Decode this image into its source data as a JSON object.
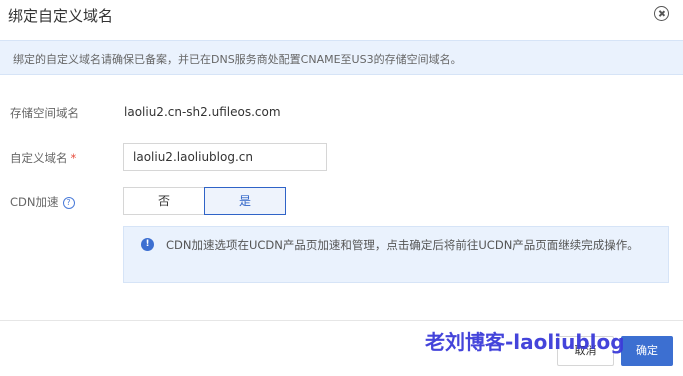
{
  "dialog": {
    "title": "绑定自定义域名"
  },
  "notice": {
    "text": "绑定的自定义域名请确保已备案，并已在DNS服务商处配置CNAME至US3的存储空间域名。"
  },
  "form": {
    "bucket_domain_label": "存储空间域名",
    "bucket_domain_value": "laoliu2.cn-sh2.ufileos.com",
    "custom_domain_label": "自定义域名",
    "required_mark": "*",
    "custom_domain_value": "laoliu2.laoliublog.cn",
    "cdn_label": "CDN加速",
    "help_glyph": "?",
    "cdn_options": [
      "否",
      "是"
    ],
    "cdn_selected": "是",
    "info_glyph": "!",
    "info_text": "CDN加速选项在UCDN产品页加速和管理，点击确定后将前往UCDN产品页面继续完成操作。"
  },
  "footer": {
    "cancel_label": "取消",
    "ok_label": "确定"
  },
  "watermark": {
    "text": "老刘博客-laoliublog"
  },
  "colors": {
    "accent": "#3c6fd1",
    "notice_bg": "#eaf2fd",
    "required": "#e74c3c",
    "watermark": "#3b3bd9"
  },
  "icons": {
    "close": "close-circle-icon",
    "help": "question-circle-icon",
    "info": "info-circle-icon"
  }
}
